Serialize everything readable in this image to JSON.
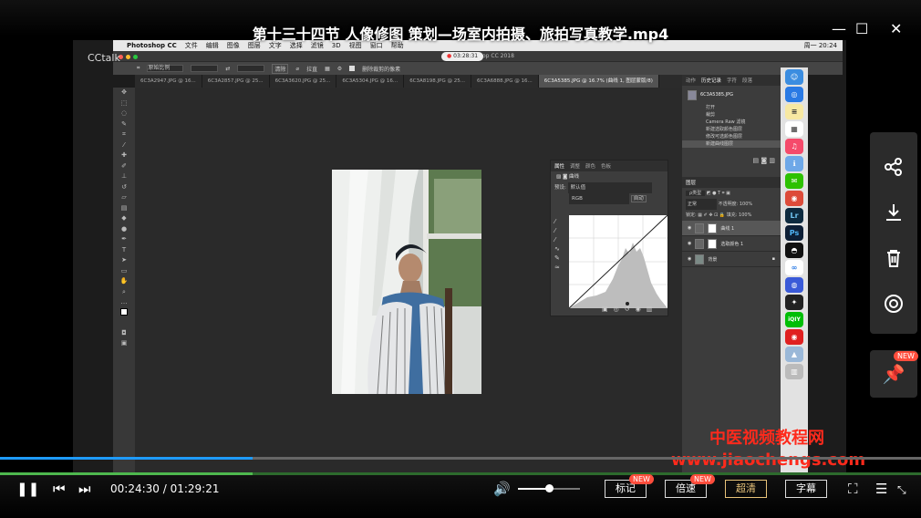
{
  "window": {
    "title": "第十三十四节 人像修图 策划—场室内拍摄、旅拍写真教学.mp4",
    "logo": "CCtalk"
  },
  "mac_menu": {
    "app": "Photoshop CC",
    "items": [
      "文件",
      "编辑",
      "图像",
      "图层",
      "文字",
      "选择",
      "滤镜",
      "3D",
      "视图",
      "窗口",
      "帮助"
    ],
    "right": "周一 20:24"
  },
  "ps": {
    "window_title": "Adobe Photoshop CC 2018",
    "rec_time": "03:28:31",
    "options": {
      "preset": "原始比例",
      "clear": "清除",
      "straighten": "拉直",
      "delete_cropped": "删除裁剪的像素"
    },
    "tabs": [
      "6C3A2947.JPG @ 16...",
      "6C3A2857.JPG @ 25...",
      "6C3A3620.JPG @ 25...",
      "6C3A5304.JPG @ 16...",
      "6C3A8198.JPG @ 25...",
      "6C3A6888.JPG @ 16...",
      "6C3A5385.JPG @ 16.7% (曲线 1, 图层蒙版/8)"
    ],
    "history": {
      "tabs": [
        "动作",
        "历史记录",
        "字符",
        "段落"
      ],
      "snapshot": "6C3A5385.JPG",
      "items": [
        "打开",
        "裁剪",
        "Camera Raw 滤镜",
        "新建选取颜色图层",
        "修改可选颜色图层",
        "新建曲线图层"
      ]
    },
    "layers": {
      "tab": "图层",
      "kind": "ρ类型",
      "blend": "正常",
      "opacity_label": "不透明度:",
      "opacity": "100%",
      "lock_label": "锁定:",
      "fill_label": "填充:",
      "fill": "100%",
      "items": [
        "曲线 1",
        "选取颜色 1",
        "背景"
      ]
    },
    "properties": {
      "tabs": [
        "属性",
        "调整",
        "颜色",
        "色板"
      ],
      "title": "曲线",
      "preset_label": "预设:",
      "preset": "默认值",
      "channel": "RGB",
      "auto": "自动"
    }
  },
  "side_panel": {
    "icons": [
      "share-icon",
      "download-icon",
      "trash-icon",
      "focus-icon"
    ],
    "pin_badge": "NEW"
  },
  "watermark": {
    "line1": "中医视频教程网",
    "line2": "www.jiaochengs.com"
  },
  "player": {
    "current": "00:24:30",
    "total": "01:29:21",
    "separator": " / ",
    "progress": 0.274,
    "volume": 0.5,
    "buttons": {
      "mark": "标记",
      "speed": "倍速",
      "hd": "超清",
      "subtitle": "字幕"
    },
    "new_badge": "NEW"
  }
}
